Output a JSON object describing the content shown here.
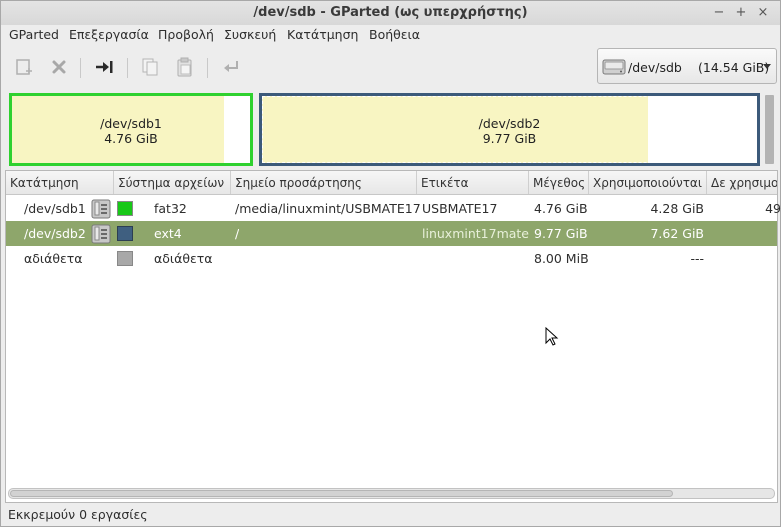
{
  "window": {
    "title": "/dev/sdb - GParted (ως υπερχρήστης)",
    "controls": [
      "−",
      "+",
      "×"
    ]
  },
  "menubar": {
    "items": [
      "GParted",
      "Επεξεργασία",
      "Προβολή",
      "Συσκευή",
      "Κατάτμηση",
      "Βοήθεια"
    ]
  },
  "toolbar": {
    "buttons": [
      "new-partition",
      "delete",
      "resize-move",
      "copy",
      "paste",
      "undo",
      "apply"
    ],
    "device": {
      "name": "/dev/sdb",
      "size": "(14.54 GiB)"
    }
  },
  "diskmap": {
    "partitions": [
      {
        "name": "/dev/sdb1",
        "size": "4.76 GiB",
        "border_color": "#2fd12f",
        "used_fraction": 0.89
      },
      {
        "name": "/dev/sdb2",
        "size": "9.77 GiB",
        "border_color": "#3c5a7a",
        "used_fraction": 0.78
      }
    ]
  },
  "table": {
    "columns": [
      "Κατάτμηση",
      "Σύστημα αρχείων",
      "Σημείο προσάρτησης",
      "Ετικέτα",
      "Μέγεθος",
      "Χρησιμοποιούνται",
      "Δε χρησιμο"
    ],
    "rows": [
      {
        "partition": "/dev/sdb1",
        "fs": "fat32",
        "fs_color": "#18c818",
        "mount": "/media/linuxmint/USBMATE17",
        "label": "USBMATE17",
        "size": "4.76 GiB",
        "used": "4.28 GiB",
        "unused": "49",
        "selected": false,
        "has_icon": true
      },
      {
        "partition": "/dev/sdb2",
        "fs": "ext4",
        "fs_color": "#3f5f80",
        "mount": "/",
        "label": "linuxmint17mate",
        "size": "9.77 GiB",
        "used": "7.62 GiB",
        "unused": "",
        "selected": true,
        "has_icon": true
      },
      {
        "partition": "αδιάθετα",
        "fs": "αδιάθετα",
        "fs_color": "#a8a8a8",
        "mount": "",
        "label": "",
        "size": "8.00 MiB",
        "used": "---",
        "unused": "",
        "selected": false,
        "has_icon": false
      }
    ]
  },
  "statusbar": {
    "text": "Εκκρεμούν 0 εργασίες"
  }
}
